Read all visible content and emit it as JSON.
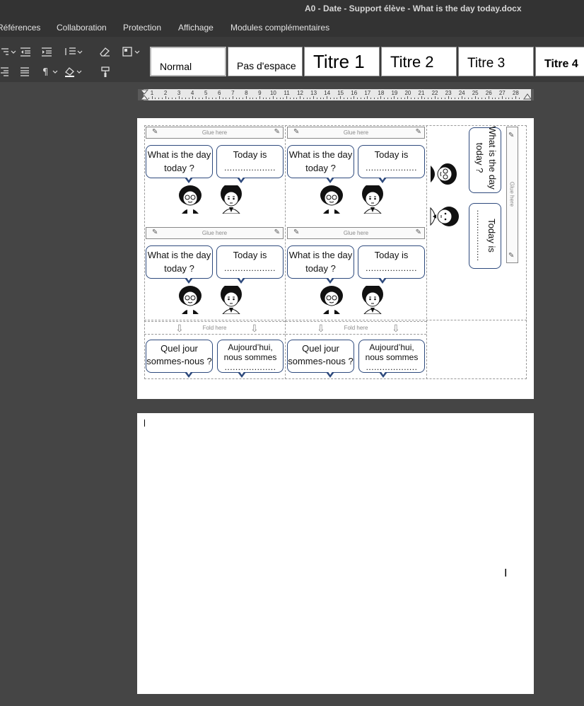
{
  "window": {
    "title": "A0 - Date - Support élève - What is the day today.docx"
  },
  "menu": {
    "items": [
      "Références",
      "Collaboration",
      "Protection",
      "Affichage",
      "Modules complémentaires"
    ]
  },
  "styles": {
    "items": [
      "Normal",
      "Pas d'espace",
      "Titre 1",
      "Titre 2",
      "Titre 3",
      "Titre 4"
    ]
  },
  "ruler": {
    "numbers": [
      "1",
      "2",
      "3",
      "4",
      "5",
      "6",
      "7",
      "8",
      "9",
      "10",
      "11",
      "12",
      "13",
      "14",
      "15",
      "16",
      "17",
      "18",
      "19",
      "20",
      "21",
      "22",
      "23",
      "24",
      "25",
      "26",
      "27",
      "28"
    ]
  },
  "worksheet": {
    "glue_label": "Glue here",
    "fold_label": "Fold here",
    "question_en": "What is the day today ?",
    "answer_en": "Today is",
    "dots": "...................",
    "question_fr": "Quel jour sommes-nous ?",
    "answer_fr": "Aujourd’hui, nous sommes"
  }
}
